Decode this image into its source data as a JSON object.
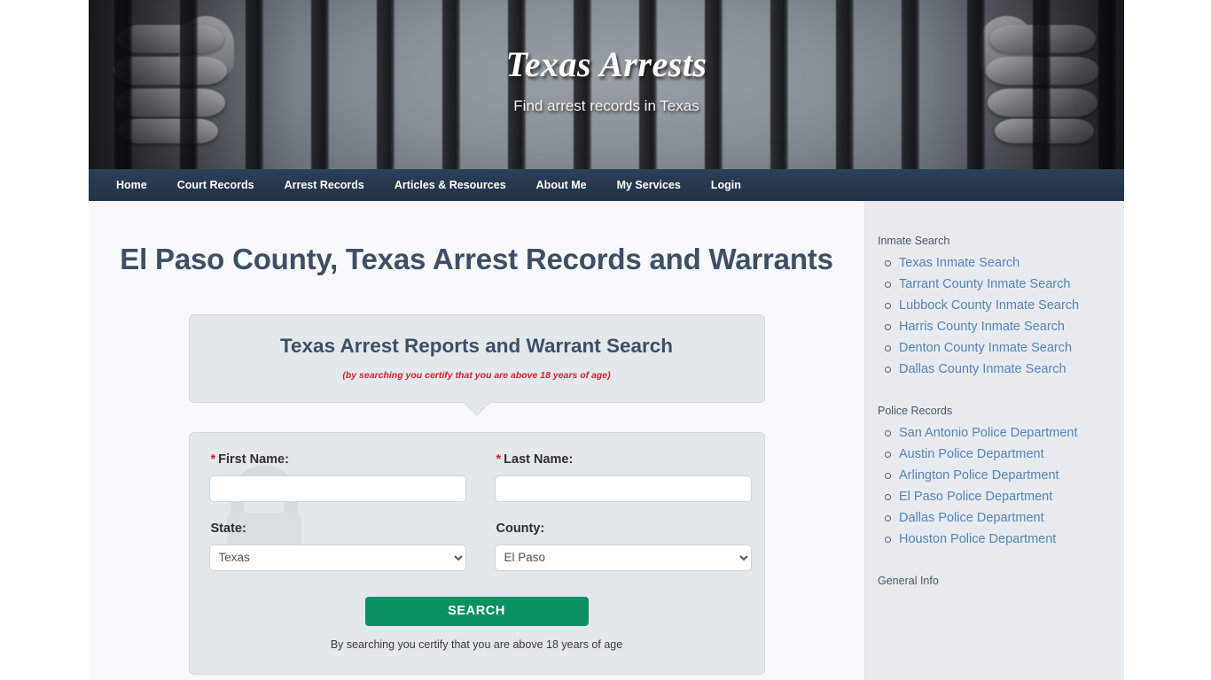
{
  "site": {
    "title": "Texas Arrests",
    "tagline": "Find arrest records in Texas"
  },
  "nav": {
    "items": [
      {
        "label": "Home"
      },
      {
        "label": "Court Records"
      },
      {
        "label": "Arrest Records"
      },
      {
        "label": "Articles & Resources"
      },
      {
        "label": "About Me"
      },
      {
        "label": "My Services"
      },
      {
        "label": "Login"
      }
    ]
  },
  "main": {
    "page_title": "El Paso County, Texas Arrest Records and Warrants",
    "banner": {
      "title": "Texas Arrest Reports and Warrant Search",
      "note": "(by searching you certify that you are above 18 years of age)"
    },
    "form": {
      "first_name": {
        "required_mark": "*",
        "label": "First Name:",
        "value": "",
        "placeholder": ""
      },
      "last_name": {
        "required_mark": "*",
        "label": "Last Name:",
        "value": "",
        "placeholder": ""
      },
      "state": {
        "label": "State:",
        "value": "Texas",
        "options": [
          "Texas"
        ]
      },
      "county": {
        "label": "County:",
        "value": "El Paso",
        "options": [
          "El Paso"
        ]
      },
      "submit_label": "SEARCH",
      "age_note": "By searching you certify that you are above 18 years of age"
    }
  },
  "sidebar": {
    "blocks": [
      {
        "heading": "Inmate Search",
        "links": [
          {
            "label": "Texas Inmate Search"
          },
          {
            "label": "Tarrant County Inmate Search"
          },
          {
            "label": "Lubbock County Inmate Search"
          },
          {
            "label": "Harris County Inmate Search"
          },
          {
            "label": "Denton County Inmate Search"
          },
          {
            "label": "Dallas County Inmate Search"
          }
        ]
      },
      {
        "heading": "Police Records",
        "links": [
          {
            "label": "San Antonio Police Department"
          },
          {
            "label": "Austin Police Department"
          },
          {
            "label": "Arlington Police Department"
          },
          {
            "label": "El Paso Police Department"
          },
          {
            "label": "Dallas Police Department"
          },
          {
            "label": "Houston Police Department"
          }
        ]
      },
      {
        "heading": "General Info",
        "links": []
      }
    ]
  },
  "colors": {
    "nav_background": "#27394f",
    "heading_text": "#3c4f66",
    "search_button": "#0b9160",
    "required_red": "#d6202a",
    "link_blue": "#5584b9",
    "sidebar_background": "#e7ebef",
    "panel_background": "#e3e8ec"
  }
}
